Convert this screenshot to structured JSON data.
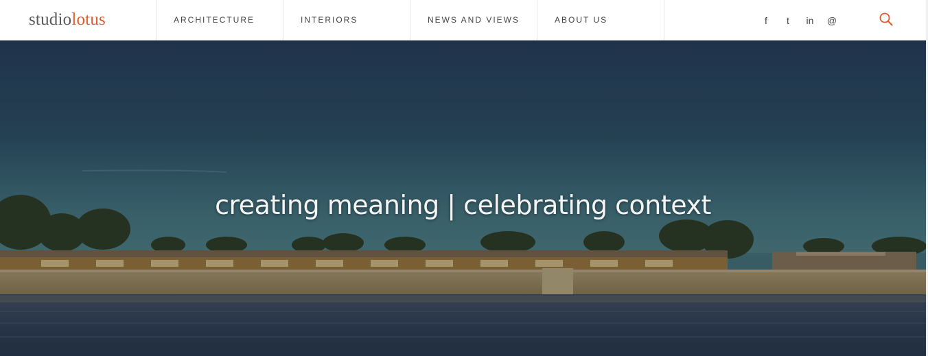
{
  "brand": {
    "logo_part_1": "studio",
    "logo_part_2": "lotus",
    "accent_color": "#e05a2b"
  },
  "nav": {
    "items": [
      {
        "label": "ARCHITECTURE"
      },
      {
        "label": "INTERIORS"
      },
      {
        "label": "NEWS AND VIEWS"
      },
      {
        "label": "ABOUT US"
      }
    ]
  },
  "social": {
    "links": [
      {
        "label": "f",
        "icon": "facebook-icon"
      },
      {
        "label": "t",
        "icon": "twitter-icon"
      },
      {
        "label": "in",
        "icon": "linkedin-icon"
      },
      {
        "label": "@",
        "icon": "email-icon"
      }
    ],
    "search_icon": "search-icon"
  },
  "hero": {
    "tagline": "creating meaning | celebrating context"
  }
}
